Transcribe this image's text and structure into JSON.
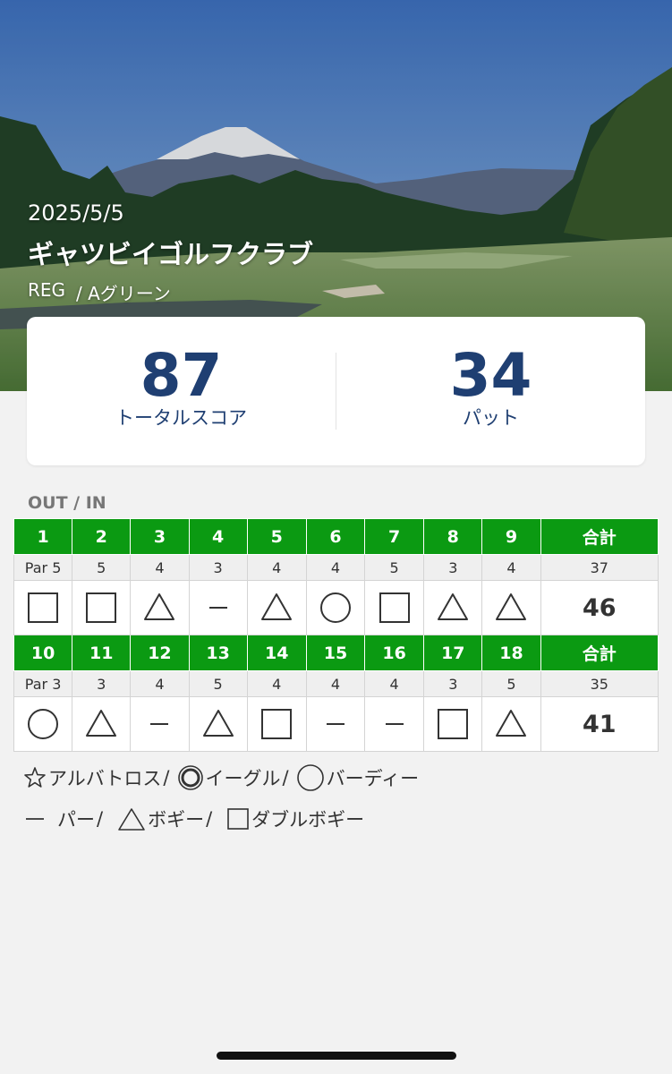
{
  "round": {
    "date": "2025/5/5",
    "club": "ギャツビイゴルフクラブ",
    "tee": "REG",
    "green": "/ Aグリーン"
  },
  "summary": {
    "total_score": "87",
    "total_score_label": "トータルスコア",
    "putts": "34",
    "putts_label": "パット"
  },
  "section_label": "OUT / IN",
  "colors": {
    "hole_header_bg": "#0b9a12",
    "score_text": "#1f3f72"
  },
  "out": {
    "holes": [
      "1",
      "2",
      "3",
      "4",
      "5",
      "6",
      "7",
      "8",
      "9"
    ],
    "total_label": "合計",
    "pars": [
      "Par 5",
      "5",
      "4",
      "3",
      "4",
      "4",
      "5",
      "3",
      "4"
    ],
    "par_total": "37",
    "results": [
      "double-bogey",
      "double-bogey",
      "bogey",
      "par",
      "bogey",
      "birdie",
      "double-bogey",
      "bogey",
      "bogey"
    ],
    "score_total": "46"
  },
  "in": {
    "holes": [
      "10",
      "11",
      "12",
      "13",
      "14",
      "15",
      "16",
      "17",
      "18"
    ],
    "total_label": "合計",
    "pars": [
      "Par 3",
      "3",
      "4",
      "5",
      "4",
      "4",
      "4",
      "3",
      "5"
    ],
    "par_total": "35",
    "results": [
      "birdie",
      "bogey",
      "par",
      "bogey",
      "double-bogey",
      "par",
      "par",
      "double-bogey",
      "bogey"
    ],
    "score_total": "41"
  },
  "legend": {
    "albatross": "アルバトロス",
    "eagle": "イーグル",
    "birdie": "バーディー",
    "par": "パー",
    "bogey": "ボギー",
    "double_bogey": "ダブルボギー",
    "separator": "/"
  }
}
